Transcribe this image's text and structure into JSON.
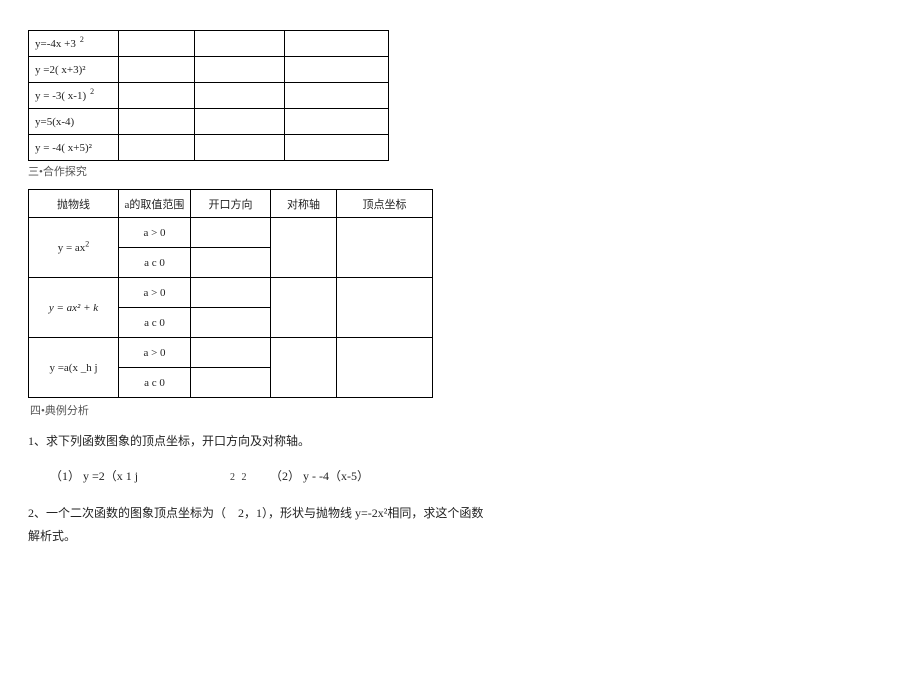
{
  "table1": {
    "rows": [
      {
        "eq": "y=-4x +3",
        "sup": "2"
      },
      {
        "eq": "y =2( x+3)²",
        "sup": ""
      },
      {
        "eq": "y = -3( x-1)",
        "sup": "2"
      },
      {
        "eq": "y=5(x-4)",
        "sup": ""
      },
      {
        "eq": "y = -4( x+5)²",
        "sup": ""
      }
    ]
  },
  "section3": "三•合作探究",
  "table2": {
    "headers": [
      "抛物线",
      "a的取值范围",
      "开口方向",
      "对称轴",
      "顶点坐标"
    ],
    "groups": [
      {
        "label": "y = ax",
        "sup": "2",
        "conds": [
          "a > 0",
          "a c 0"
        ]
      },
      {
        "label_html": "y = ax² + k",
        "conds": [
          "a > 0",
          "a c 0"
        ]
      },
      {
        "label": "y =a(x _h j",
        "sup": "",
        "conds": [
          "a > 0",
          "a c 0"
        ]
      }
    ]
  },
  "section4": "四•典例分析",
  "q1": "1、求下列函数图象的顶点坐标，开口方向及对称轴。",
  "q1_item1_label": "（1）",
  "q1_item1_expr": "y =2（x 1 j",
  "q1_mid_exp": "2 2",
  "q1_item2_label": "（2）",
  "q1_item2_expr": "y - -4（x-5）",
  "q2_line1": "2、一个二次函数的图象顶点坐标为（　2，1），形状与抛物线 y=-2x²相同，求这个函数",
  "q2_line2": "解析式。"
}
